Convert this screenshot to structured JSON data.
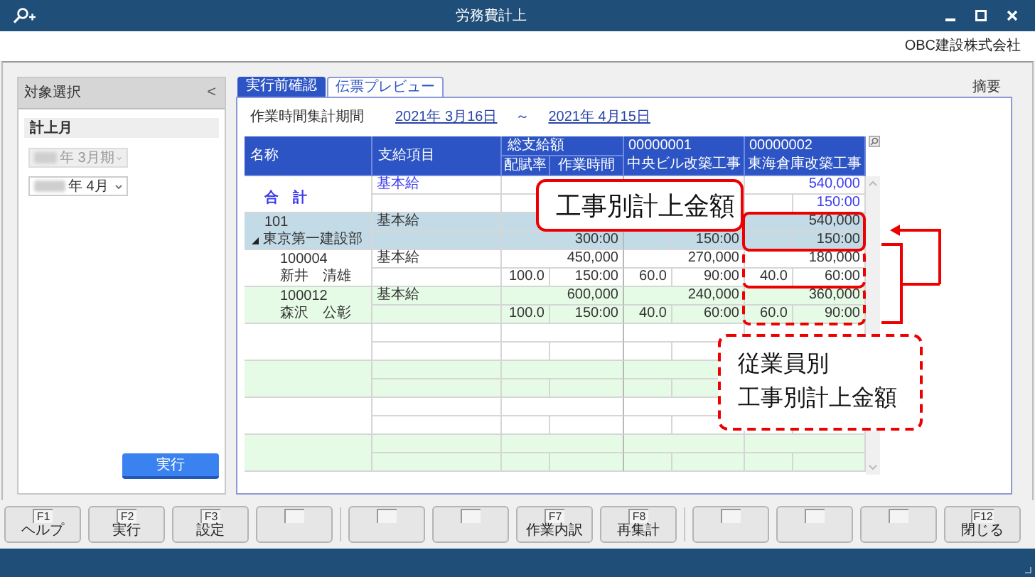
{
  "window": {
    "title": "労務費計上",
    "company": "OBC建設株式会社"
  },
  "side_panel": {
    "title": "対象選択",
    "collapse": "<",
    "section": "計上月",
    "fields": [
      {
        "value": "年 3月期",
        "disabled": true
      },
      {
        "value": "年 4月",
        "disabled": false
      }
    ],
    "run_button": "実行"
  },
  "tabs": [
    {
      "label": "実行前確認",
      "selected": true
    },
    {
      "label": "伝票プレビュー",
      "selected": false
    }
  ],
  "remarks": "摘要",
  "period": {
    "label": "作業時間集計期間",
    "from": "2021年 3月16日",
    "separator": "～",
    "to": "2021年 4月15日"
  },
  "table": {
    "headers": {
      "name": "名称",
      "item": "支給項目",
      "total": "総支給額",
      "rate": "配賦率",
      "hours": "作業時間",
      "projects": [
        {
          "code": "00000001",
          "name": "中央ビル改築工事"
        },
        {
          "code": "00000002",
          "name": "東海倉庫改築工事"
        }
      ]
    },
    "rows": [
      {
        "kind": "total",
        "name": "合　計",
        "item": "基本給",
        "cells": {
          "amount_2": "540,000",
          "hours_2": "150:00"
        }
      },
      {
        "kind": "group",
        "code": "101",
        "name": "東京第一建設部",
        "expanded": true,
        "item": "基本給",
        "cells": {
          "amount_2": "540,000",
          "hours_total": "300:00",
          "hours_1": "150:00",
          "hours_2": "150:00"
        },
        "children": [
          {
            "kind": "employee",
            "code": "100004",
            "name": "新井　清雄",
            "item": "基本給",
            "cells": {
              "amount_total": "450,000",
              "amount_1": "270,000",
              "amount_2": "180,000",
              "rate_total": "100.0",
              "hours_total": "150:00",
              "rate_1": "60.0",
              "hours_1": "90:00",
              "rate_2": "40.0",
              "hours_2": "60:00"
            }
          },
          {
            "kind": "employee",
            "code": "100012",
            "name": "森沢　公彰",
            "item": "基本給",
            "cells": {
              "amount_total": "600,000",
              "amount_1": "240,000",
              "amount_2": "360,000",
              "rate_total": "100.0",
              "hours_total": "150:00",
              "rate_1": "40.0",
              "hours_1": "60:00",
              "rate_2": "60.0",
              "hours_2": "90:00"
            }
          }
        ]
      }
    ]
  },
  "annotations": [
    {
      "lines": [
        "工事別計上金額"
      ]
    },
    {
      "lines": [
        "従業員別",
        "工事別計上金額"
      ]
    }
  ],
  "function_keys": [
    {
      "kind": "key",
      "key": "F1",
      "label": "ヘルプ"
    },
    {
      "kind": "key",
      "key": "F2",
      "label": "実行"
    },
    {
      "kind": "key",
      "key": "F3",
      "label": "設定"
    },
    {
      "kind": "blank"
    },
    {
      "kind": "blank"
    },
    {
      "kind": "blank"
    },
    {
      "kind": "key",
      "key": "F7",
      "label": "作業内訳"
    },
    {
      "kind": "key",
      "key": "F8",
      "label": "再集計"
    },
    {
      "kind": "blank"
    },
    {
      "kind": "blank"
    },
    {
      "kind": "blank"
    },
    {
      "kind": "key",
      "key": "F12",
      "label": "閉じる"
    }
  ]
}
